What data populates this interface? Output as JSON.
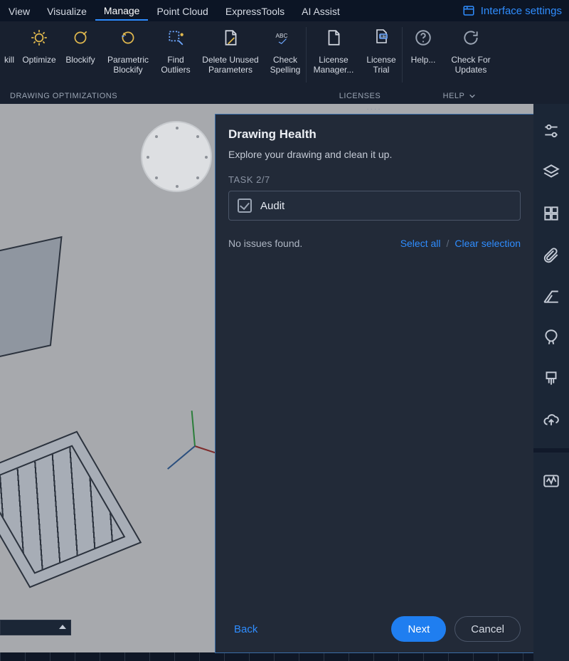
{
  "menubar": {
    "tabs": [
      "View",
      "Visualize",
      "Manage",
      "Point Cloud",
      "ExpressTools",
      "AI Assist"
    ],
    "active_index": 2,
    "interface_settings": "Interface settings"
  },
  "ribbon": {
    "items": [
      {
        "id": "kill",
        "label": "kill"
      },
      {
        "id": "optimize",
        "label": "Optimize"
      },
      {
        "id": "blockify",
        "label": "Blockify"
      },
      {
        "id": "param-blockify",
        "label": "Parametric\nBlockify"
      },
      {
        "id": "find-outliers",
        "label": "Find\nOutliers"
      },
      {
        "id": "delete-unused",
        "label": "Delete Unused\nParameters"
      },
      {
        "id": "check-spelling",
        "label": "Check\nSpelling"
      },
      {
        "id": "license-manager",
        "label": "License\nManager..."
      },
      {
        "id": "license-trial",
        "label": "License\nTrial"
      },
      {
        "id": "help",
        "label": "Help..."
      },
      {
        "id": "check-updates",
        "label": "Check For\nUpdates"
      }
    ],
    "panels": {
      "drawing_opt": "DRAWING OPTIMIZATIONS",
      "licenses": "LICENSES",
      "help": "HELP"
    }
  },
  "panel": {
    "title": "Drawing Health",
    "subtitle": "Explore your drawing and clean it up.",
    "task_label": "TASK 2/7",
    "task_name": "Audit",
    "no_issues": "No issues found.",
    "select_all": "Select all",
    "clear_selection": "Clear selection",
    "back": "Back",
    "next": "Next",
    "cancel": "Cancel"
  },
  "rail": {
    "tools": [
      "settings-sliders-icon",
      "layers-icon",
      "grid-icon",
      "attachment-icon",
      "crop-icon",
      "balloon-icon",
      "brush-icon",
      "cloud-upload-icon",
      "activity-icon"
    ]
  }
}
